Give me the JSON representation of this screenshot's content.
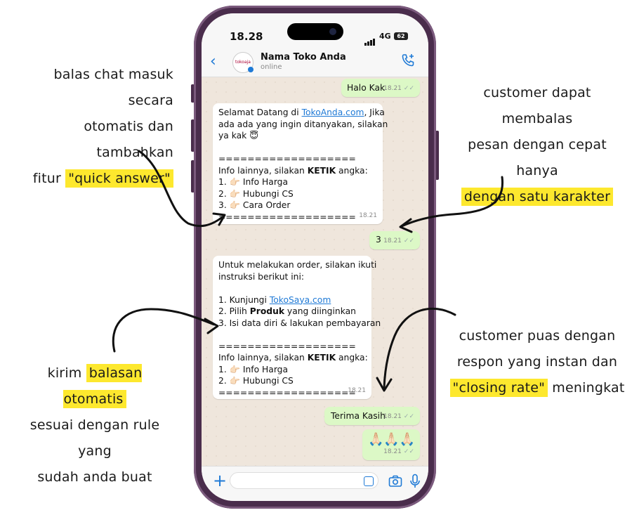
{
  "annotations": {
    "left_top": {
      "line1": "balas chat masuk secara",
      "line2": "otomatis dan tambahkan",
      "line3_pre": "fitur ",
      "line3_hl": "\"quick answer\""
    },
    "left_bottom": {
      "line1_pre": "kirim ",
      "line1_hl": "balasan otomatis",
      "line2": "sesuai dengan rule yang",
      "line3": "sudah anda buat"
    },
    "right_top": {
      "line1": "customer dapat membalas",
      "line2": "pesan dengan cepat hanya",
      "line3_hl": "dengan satu karakter"
    },
    "right_bottom": {
      "line1": "customer puas dengan",
      "line2": "respon yang instan dan",
      "line3_hl": "\"closing rate\"",
      "line3_post": " meningkat"
    }
  },
  "status_bar": {
    "time": "18.28",
    "network": "4G",
    "battery": "62"
  },
  "header": {
    "back_icon": "chevron-left-icon",
    "avatar_text": "tokoaja",
    "contact_name": "Nama Toko Anda",
    "contact_status": "online",
    "call_icon": "phone-add-icon"
  },
  "messages": {
    "m1": {
      "text": "Halo Kak",
      "time": "18.21"
    },
    "m2": {
      "l1_pre": "Selamat Datang di ",
      "l1_link": "TokoAnda.com",
      "l1_post": ", Jika",
      "l2": "ada ada yang ingin ditanyakan, silakan",
      "l3": "ya kak 😇",
      "sep1": "===================",
      "l5_pre": "Info lainnya, silakan ",
      "l5_bold": "KETIK",
      "l5_post": " angka:",
      "o1": "1. 👉🏻 Info Harga",
      "o2": "2. 👉🏻 Hubungi CS",
      "o3": "3. 👉🏻 Cara Order",
      "sep2": "===================",
      "time": "18.21"
    },
    "m3": {
      "text": "3",
      "time": "18.21"
    },
    "m4": {
      "l1": "Untuk melakukan order, silakan ikuti",
      "l2": "instruksi berikut ini:",
      "s1_pre": "1. Kunjungi ",
      "s1_link": "TokoSaya.com",
      "s2_pre": "2. Pilih ",
      "s2_bold": "Produk",
      "s2_post": " yang diinginkan",
      "s3": "3. Isi data diri & lakukan pembayaran",
      "sep1": "===================",
      "l8_pre": "Info lainnya, silakan ",
      "l8_bold": "KETIK",
      "l8_post": " angka:",
      "o1": "1. 👉🏻 Info Harga",
      "o2": "2. 👉🏻 Hubungi CS",
      "sep2": "===================",
      "time": "18.21"
    },
    "m5": {
      "text": "Terima Kasih",
      "time": "18.21"
    },
    "m6": {
      "text": "🙏🏻🙏🏻🙏🏻",
      "time": "18.21"
    }
  },
  "input_bar": {
    "placeholder": "",
    "plus_icon": "plus-icon",
    "sticker_icon": "sticker-icon",
    "camera_icon": "camera-icon",
    "mic_icon": "microphone-icon"
  },
  "colors": {
    "phone_frame": "#4a2d4c",
    "highlight": "#fde82e",
    "accent": "#1f7ad6",
    "outgoing_bubble": "#dcf8c6",
    "chat_background": "#efe6dc"
  }
}
